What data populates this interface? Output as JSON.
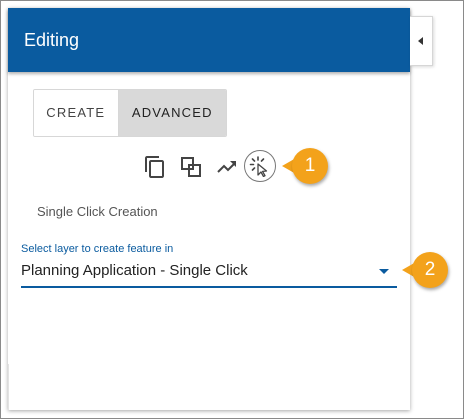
{
  "header": {
    "title": "Editing"
  },
  "tabs": [
    {
      "label": "CREATE",
      "selected": false
    },
    {
      "label": "ADVANCED",
      "selected": true
    }
  ],
  "tools": [
    {
      "icon": "copy-icon"
    },
    {
      "icon": "duplicate-icon"
    },
    {
      "icon": "trend-icon"
    },
    {
      "icon": "single-click-icon",
      "active": true
    }
  ],
  "callouts": {
    "one": "1",
    "two": "2"
  },
  "section": {
    "title": "Single Click Creation"
  },
  "layer_select": {
    "label": "Select layer to create feature in",
    "value": "Planning Application - Single Click"
  },
  "colors": {
    "header": "#0a5b9f",
    "accent": "#0a5b9f",
    "callout": "#f3a21b",
    "tab_selected": "#d9d9d9"
  }
}
